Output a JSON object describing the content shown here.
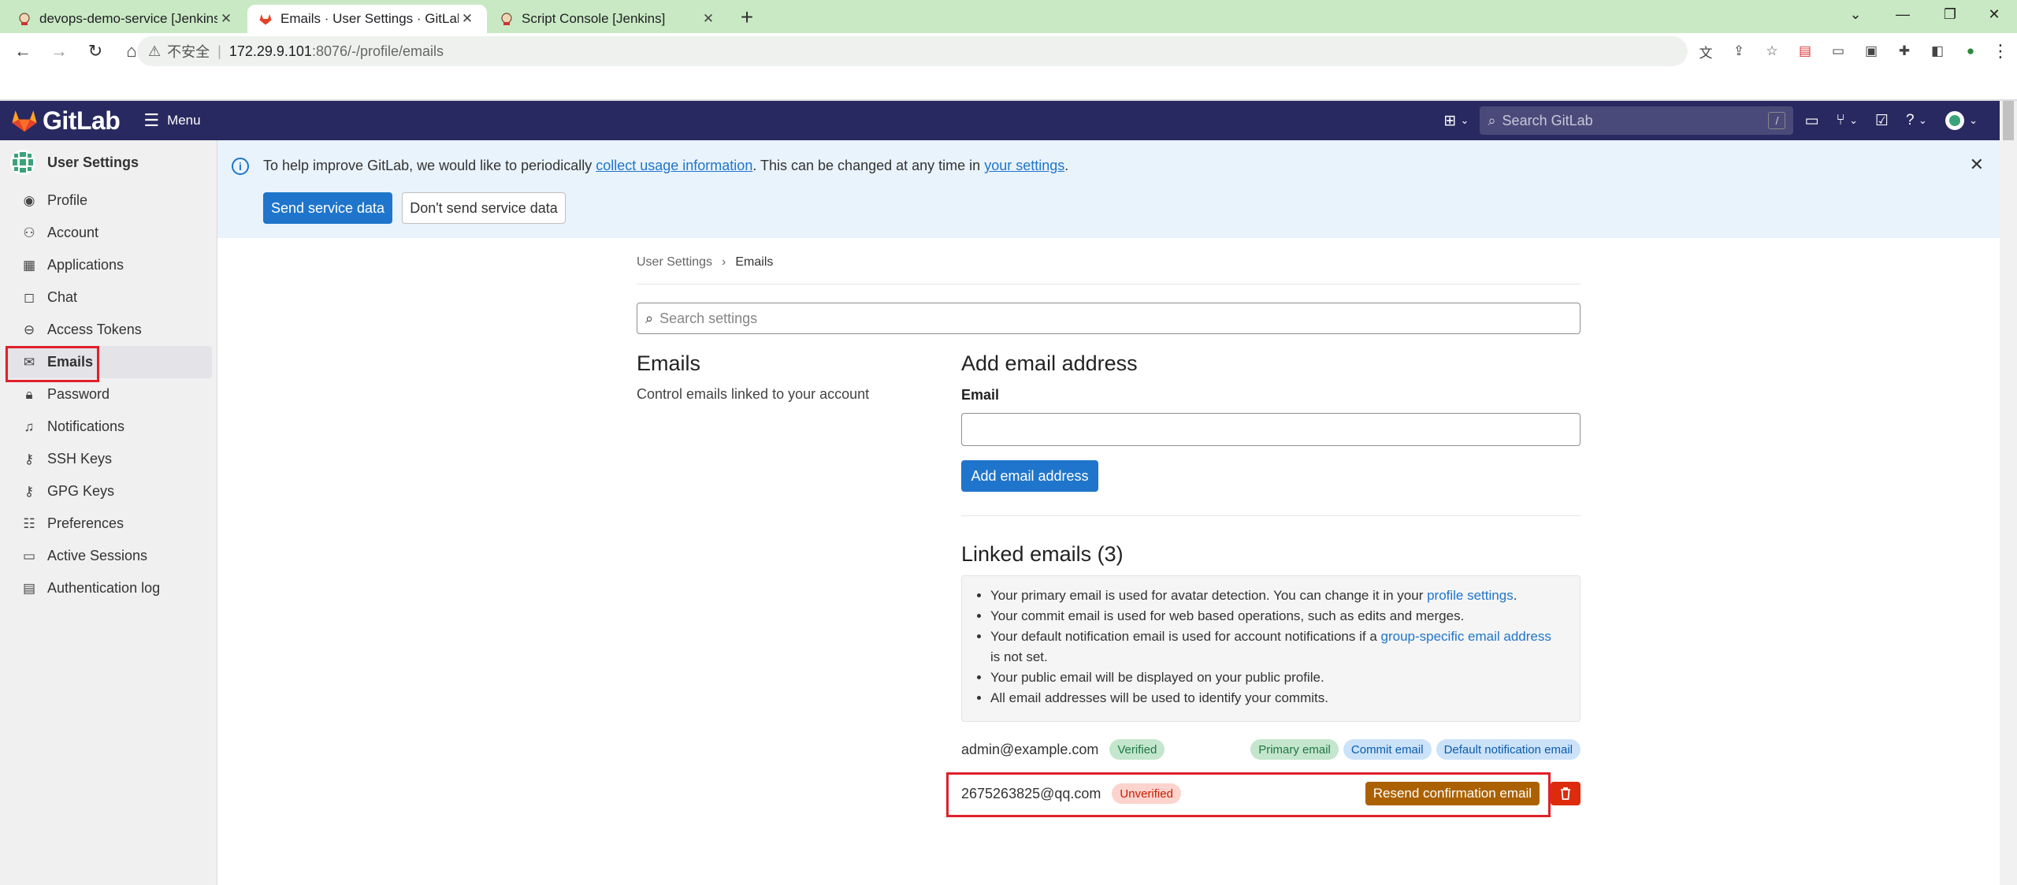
{
  "browser": {
    "tabs": [
      {
        "title": "devops-demo-service [Jenkins]",
        "icon": "jenkins-icon"
      },
      {
        "title": "Emails · User Settings · GitLab",
        "icon": "gitlab-icon",
        "active": true
      },
      {
        "title": "Script Console [Jenkins]",
        "icon": "jenkins-icon"
      }
    ],
    "security_label": "不安全",
    "url_host": "172.29.9.101",
    "url_path": ":8076/-/profile/emails"
  },
  "gitlab_nav": {
    "brand": "GitLab",
    "menu_label": "Menu",
    "search_placeholder": "Search GitLab",
    "search_shortcut": "/"
  },
  "sidebar": {
    "title": "User Settings",
    "items": [
      {
        "label": "Profile",
        "icon": "user-icon"
      },
      {
        "label": "Account",
        "icon": "account-icon"
      },
      {
        "label": "Applications",
        "icon": "grid-icon"
      },
      {
        "label": "Chat",
        "icon": "chat-icon"
      },
      {
        "label": "Access Tokens",
        "icon": "token-icon"
      },
      {
        "label": "Emails",
        "icon": "mail-icon",
        "active": true
      },
      {
        "label": "Password",
        "icon": "lock-icon"
      },
      {
        "label": "Notifications",
        "icon": "bell-icon"
      },
      {
        "label": "SSH Keys",
        "icon": "key-icon"
      },
      {
        "label": "GPG Keys",
        "icon": "key-icon"
      },
      {
        "label": "Preferences",
        "icon": "preferences-icon"
      },
      {
        "label": "Active Sessions",
        "icon": "monitor-icon"
      },
      {
        "label": "Authentication log",
        "icon": "log-icon"
      }
    ]
  },
  "banner": {
    "text_before": "To help improve GitLab, we would like to periodically ",
    "link1": "collect usage information",
    "text_middle": ". This can be changed at any time in ",
    "link2": "your settings",
    "text_after": ".",
    "send_button": "Send service data",
    "dont_send_button": "Don't send service data"
  },
  "breadcrumb": {
    "parent": "User Settings",
    "current": "Emails"
  },
  "settings_search_placeholder": "Search settings",
  "emails_section": {
    "title": "Emails",
    "description": "Control emails linked to your account"
  },
  "add_email": {
    "title": "Add email address",
    "field_label": "Email",
    "field_value": "",
    "button": "Add email address"
  },
  "linked": {
    "title": "Linked emails (3)",
    "info": {
      "li1_text": "Your primary email is used for avatar detection. You can change it in your ",
      "li1_link": "profile settings",
      "li1_end": ".",
      "li2": "Your commit email is used for web based operations, such as edits and merges.",
      "li3_text": "Your default notification email is used for account notifications if a ",
      "li3_link": "group-specific email address",
      "li3_end": " is not set.",
      "li4": "Your public email will be displayed on your public profile.",
      "li5": "All email addresses will be used to identify your commits."
    },
    "emails": [
      {
        "address": "admin@example.com",
        "status": "Verified",
        "tags": [
          "Primary email",
          "Commit email",
          "Default notification email"
        ]
      },
      {
        "address": "2675263825@qq.com",
        "status": "Unverified",
        "action": "Resend confirmation email"
      }
    ]
  },
  "colors": {
    "nav_bg": "#292961",
    "primary": "#1f75cb",
    "highlight_box": "#e0202a",
    "resend_bg": "#ab6100",
    "delete_bg": "#dd2b0e"
  }
}
